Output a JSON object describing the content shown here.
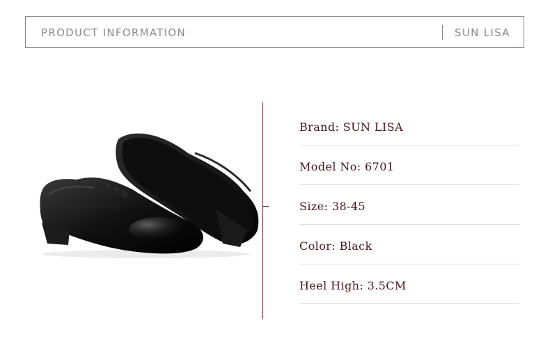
{
  "header": {
    "title": "PRODUCT INFORMATION",
    "brand": "SUN LISA"
  },
  "product_image": {
    "alt": "Black leather dance shoes"
  },
  "specs": [
    {
      "label": "Brand",
      "separator": ": ",
      "value": "SUN LISA"
    },
    {
      "label": "Model No",
      "separator": ": ",
      "value": "6701"
    },
    {
      "label": "Size",
      "separator": ": ",
      "value": "38-45"
    },
    {
      "label": "Color",
      "separator": ": ",
      "value": "Black"
    },
    {
      "label": "Heel High",
      "separator": ": ",
      "value": "3.5CM"
    }
  ],
  "colors": {
    "accent": "#6b1e24",
    "text": "#4a1419",
    "header_text": "#8a8a8a"
  }
}
